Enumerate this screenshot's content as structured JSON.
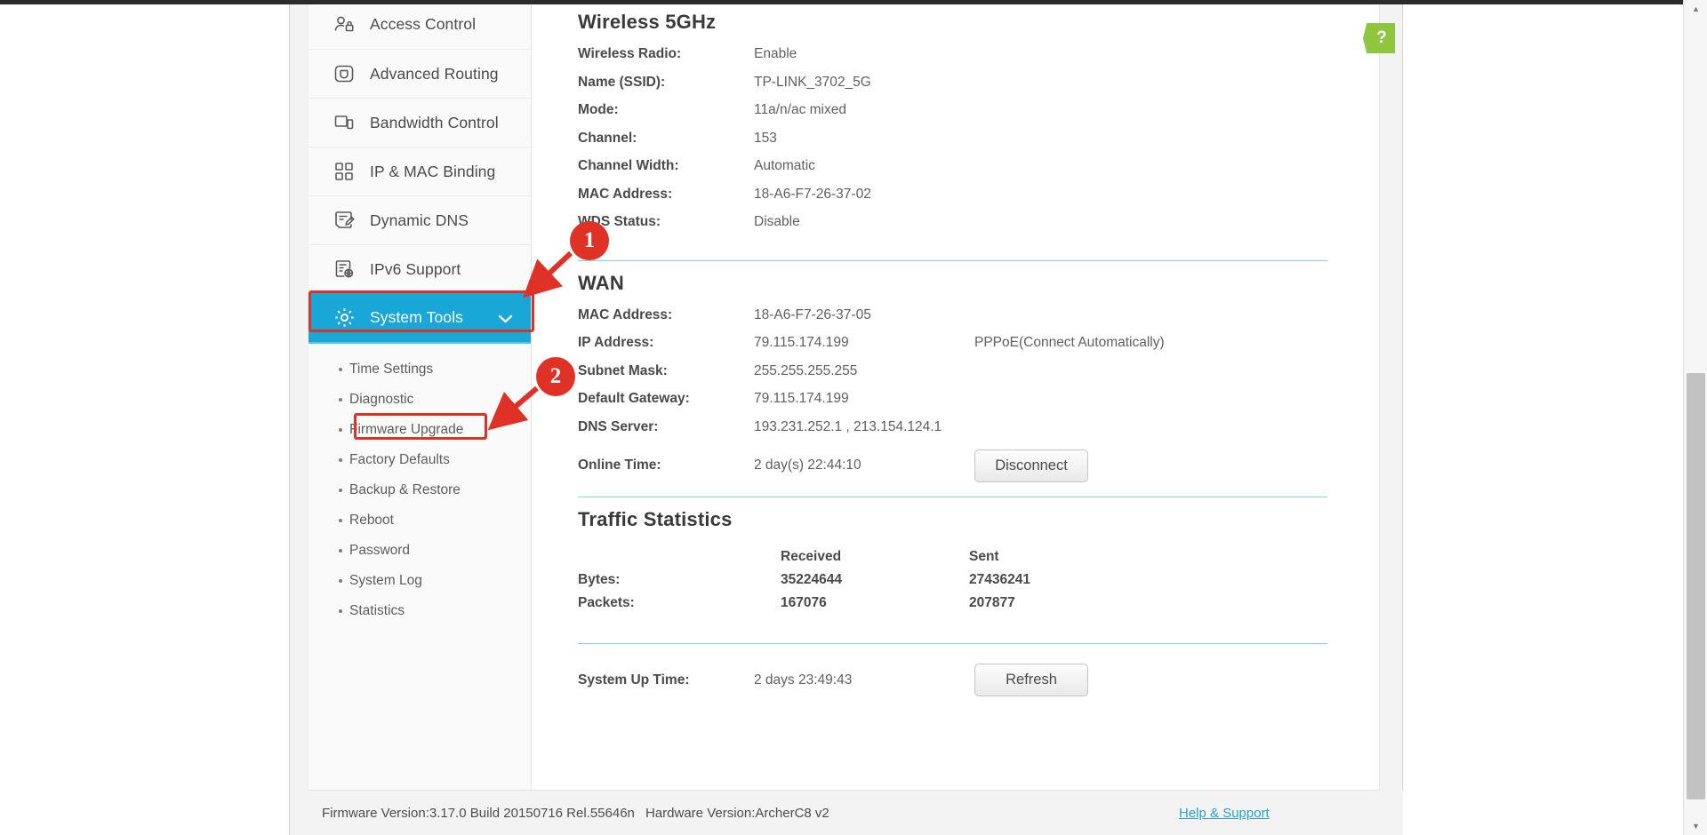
{
  "sidebar": {
    "items": [
      {
        "label": "Access Control",
        "icon": "user-lock-icon"
      },
      {
        "label": "Advanced Routing",
        "icon": "router-icon"
      },
      {
        "label": "Bandwidth Control",
        "icon": "bandwidth-icon"
      },
      {
        "label": "IP & MAC Binding",
        "icon": "grid-blocks-icon"
      },
      {
        "label": "Dynamic DNS",
        "icon": "edit-document-icon"
      },
      {
        "label": "IPv6 Support",
        "icon": "ipv6-globe-icon"
      },
      {
        "label": "System Tools",
        "icon": "gear-icon",
        "active": true,
        "chevron": "chevron-down-icon"
      }
    ],
    "submenu": [
      {
        "label": "Time Settings"
      },
      {
        "label": "Diagnostic"
      },
      {
        "label": "Firmware Upgrade",
        "highlighted": true
      },
      {
        "label": "Factory Defaults"
      },
      {
        "label": "Backup & Restore"
      },
      {
        "label": "Reboot"
      },
      {
        "label": "Password"
      },
      {
        "label": "System Log"
      },
      {
        "label": "Statistics"
      }
    ]
  },
  "wireless5g": {
    "title": "Wireless 5GHz",
    "rows": [
      {
        "label": "Wireless Radio:",
        "value": "Enable"
      },
      {
        "label": "Name (SSID):",
        "value": "TP-LINK_3702_5G"
      },
      {
        "label": "Mode:",
        "value": "11a/n/ac mixed"
      },
      {
        "label": "Channel:",
        "value": "153"
      },
      {
        "label": "Channel Width:",
        "value": "Automatic"
      },
      {
        "label": "MAC Address:",
        "value": "18-A6-F7-26-37-02"
      },
      {
        "label": "WDS Status:",
        "value": "Disable"
      }
    ]
  },
  "wan": {
    "title": "WAN",
    "rows": [
      {
        "label": "MAC Address:",
        "value": "18-A6-F7-26-37-05",
        "extra": ""
      },
      {
        "label": "IP Address:",
        "value": "79.115.174.199",
        "extra": "PPPoE(Connect Automatically)"
      },
      {
        "label": "Subnet Mask:",
        "value": "255.255.255.255",
        "extra": ""
      },
      {
        "label": "Default Gateway:",
        "value": "79.115.174.199",
        "extra": ""
      },
      {
        "label": "DNS Server:",
        "value": "193.231.252.1 , 213.154.124.1",
        "extra": ""
      }
    ],
    "online_time_label": "Online Time:",
    "online_time_value": "2 day(s) 22:44:10",
    "disconnect_label": "Disconnect"
  },
  "traffic": {
    "title": "Traffic Statistics",
    "columns": [
      "Received",
      "Sent"
    ],
    "rows": [
      {
        "label": "Bytes:",
        "received": "35224644",
        "sent": "27436241"
      },
      {
        "label": "Packets:",
        "received": "167076",
        "sent": "207877"
      }
    ]
  },
  "uptime": {
    "label": "System Up Time:",
    "value": "2 days 23:49:43",
    "refresh_label": "Refresh"
  },
  "help_tab": {
    "glyph": "?",
    "icon": "help-question-icon"
  },
  "annotations": {
    "badge1": "1",
    "badge2": "2"
  },
  "footer": {
    "firmware": "Firmware Version:3.17.0 Build 20150716 Rel.55646n",
    "hardware": "Hardware Version:ArcherC8 v2",
    "help_link": "Help & Support"
  },
  "colors": {
    "accent": "#19a7d8",
    "accent_underline": "#4fc6e8",
    "divider": "#7fd4e0",
    "annotation": "#e03127",
    "help_green": "#8fc63d",
    "link": "#2aa3c4"
  }
}
